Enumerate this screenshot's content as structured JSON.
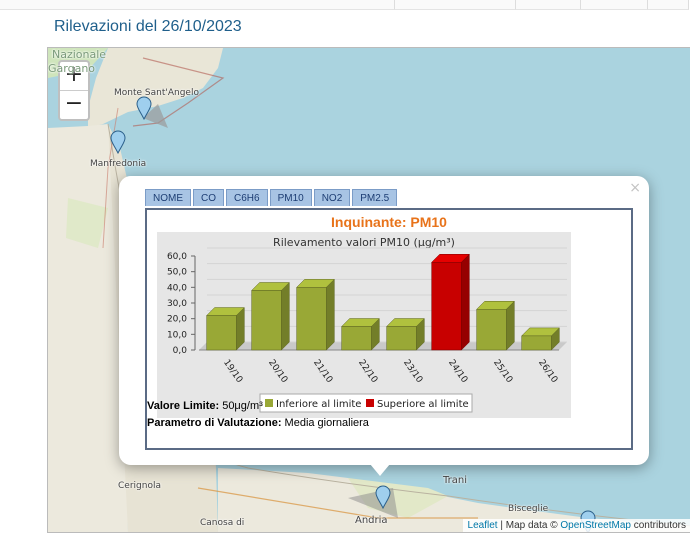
{
  "header": {
    "title": "Rilevazioni del 26/10/2023"
  },
  "map": {
    "zoom_in": "+",
    "zoom_out": "−",
    "places": [
      {
        "name": "Nazionale",
        "id": "p1"
      },
      {
        "name": "Gargano",
        "id": "p2"
      },
      {
        "name": "Monte Sant'Angelo",
        "id": "p3"
      },
      {
        "name": "Manfredonia",
        "id": "p4"
      },
      {
        "name": "Cerignola",
        "id": "p5"
      },
      {
        "name": "Trani",
        "id": "p6"
      },
      {
        "name": "Bisceglie",
        "id": "p7"
      },
      {
        "name": "Andria",
        "id": "p8"
      },
      {
        "name": "Canosa di",
        "id": "p9"
      }
    ],
    "attribution": {
      "leaflet": "Leaflet",
      "sep": " | Map data © ",
      "osm": "OpenStreetMap",
      "suffix": " contributors"
    }
  },
  "popup": {
    "close": "×",
    "tabs": [
      "NOME",
      "CO",
      "C6H6",
      "PM10",
      "NO2",
      "PM2.5"
    ],
    "pollutant_title": "Inquinante: PM10",
    "limit_label": "Valore Limite:",
    "limit_value": " 50μg/m³",
    "param_label": "Parametro di Valutazione:",
    "param_value": " Media giornaliera"
  },
  "colors": {
    "below": "#99a836",
    "above": "#c80000",
    "title": "#e8731a"
  },
  "chart_data": {
    "type": "bar",
    "title": "Rilevamento valori PM10 (μg/m³)",
    "categories": [
      "19/10",
      "20/10",
      "21/10",
      "22/10",
      "23/10",
      "24/10",
      "25/10",
      "26/10"
    ],
    "values": [
      22,
      38,
      40,
      15,
      15,
      56,
      26,
      9
    ],
    "status": [
      "below",
      "below",
      "below",
      "below",
      "below",
      "above",
      "below",
      "below"
    ],
    "yticks": [
      "60,0",
      "50,0",
      "40,0",
      "30,0",
      "20,0",
      "10,0",
      "0,0"
    ],
    "ylim": [
      0,
      60
    ],
    "legend": [
      "Inferiore al limite",
      "Superiore al limite"
    ],
    "legend_position": "bottom"
  }
}
